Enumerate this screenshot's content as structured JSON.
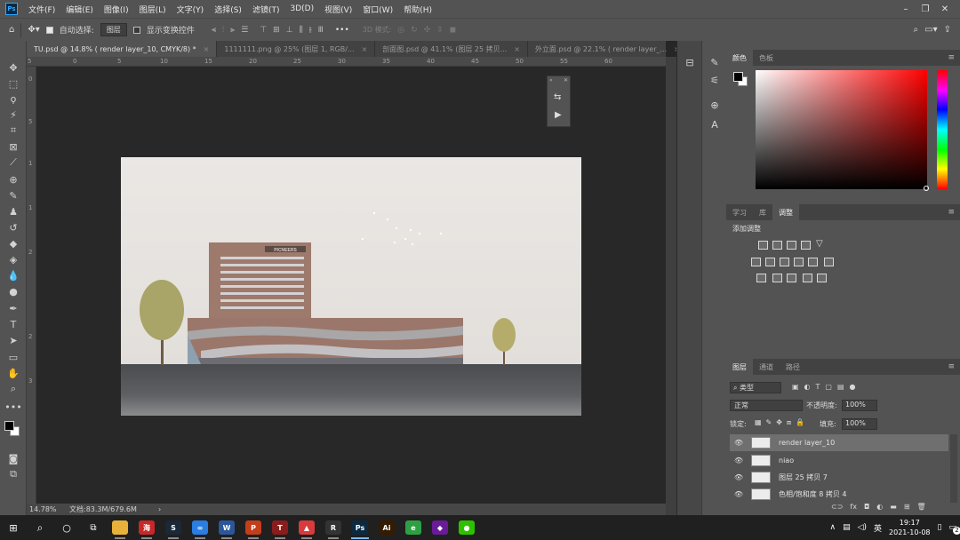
{
  "app": {
    "logo": "Ps"
  },
  "menu": [
    "文件(F)",
    "编辑(E)",
    "图像(I)",
    "图层(L)",
    "文字(Y)",
    "选择(S)",
    "滤镜(T)",
    "3D(D)",
    "视图(V)",
    "窗口(W)",
    "帮助(H)"
  ],
  "options": {
    "auto_select_label": "自动选择:",
    "auto_select_value": "图层",
    "transform_label": "显示变换控件",
    "mode_3d_label": "3D 模式:",
    "more": "•••"
  },
  "tabs": [
    {
      "label": "TU.psd @ 14.8% ( render layer_10, CMYK/8) *",
      "close": "×"
    },
    {
      "label": "1111111.png @ 25% (图层 1, RGB/...",
      "close": "×"
    },
    {
      "label": "剖面图.psd @ 41.1% (图层 25 拷贝...",
      "close": "×"
    },
    {
      "label": "外立面.psd @ 22.1% ( render layer_...",
      "close": "×"
    }
  ],
  "ruler": {
    "top": [
      "5",
      "0",
      "5",
      "10",
      "15",
      "20",
      "25",
      "30",
      "35",
      "40",
      "45",
      "50",
      "55",
      "60"
    ],
    "left": [
      "0",
      "5",
      "1",
      "1",
      "2",
      "2",
      "3"
    ]
  },
  "status": {
    "zoom": "14.78%",
    "doc": "文档:83.3M/679.6M",
    "arrow": "›"
  },
  "color_panel": {
    "tabs": [
      "颜色",
      "色板"
    ],
    "foreground": "#000000",
    "background": "#ffffff"
  },
  "adjust_panel": {
    "tabs": [
      "学习",
      "库",
      "调整"
    ],
    "title": "添加调整"
  },
  "layers_panel": {
    "tabs": [
      "图层",
      "通道",
      "路径"
    ],
    "filter_label": "类型",
    "blend_mode": "正常",
    "opacity_label": "不透明度:",
    "opacity_value": "100%",
    "lock_label": "锁定:",
    "fill_label": "填充:",
    "fill_value": "100%",
    "layers": [
      {
        "name": "render layer_10",
        "active": true
      },
      {
        "name": "niao",
        "active": false
      },
      {
        "name": "图层 25 拷贝 7",
        "active": false
      },
      {
        "name": "色相/饱和度 8 拷贝 4",
        "active": false
      }
    ],
    "footer_fx": "fx"
  },
  "building": {
    "sign": "PICNEERS"
  },
  "taskbar": {
    "time": "19:17",
    "date": "2021-10-08",
    "ime": "英",
    "notif": "2",
    "apps": [
      {
        "name": "file-explorer",
        "glyph": "",
        "color": "#e8b23a"
      },
      {
        "name": "haishun",
        "glyph": "海",
        "color": "#c62828"
      },
      {
        "name": "steam",
        "glyph": "S",
        "color": "#1b2838"
      },
      {
        "name": "baidu-netdisk",
        "glyph": "∞",
        "color": "#2a7de1"
      },
      {
        "name": "word",
        "glyph": "W",
        "color": "#2b579a"
      },
      {
        "name": "powerpoint",
        "glyph": "P",
        "color": "#c43e1c"
      },
      {
        "name": "tool-t",
        "glyph": "T",
        "color": "#8a1c1c"
      },
      {
        "name": "lighthouse",
        "glyph": "▲",
        "color": "#d83b3b"
      },
      {
        "name": "rhino",
        "glyph": "R",
        "color": "#333333"
      },
      {
        "name": "photoshop",
        "glyph": "Ps",
        "color": "#0b2a42"
      },
      {
        "name": "illustrator",
        "glyph": "Ai",
        "color": "#331c00"
      },
      {
        "name": "browser-360",
        "glyph": "e",
        "color": "#2ea043"
      },
      {
        "name": "app-purple",
        "glyph": "◆",
        "color": "#6a1b9a"
      },
      {
        "name": "wechat",
        "glyph": "●",
        "color": "#2dc100"
      }
    ]
  }
}
